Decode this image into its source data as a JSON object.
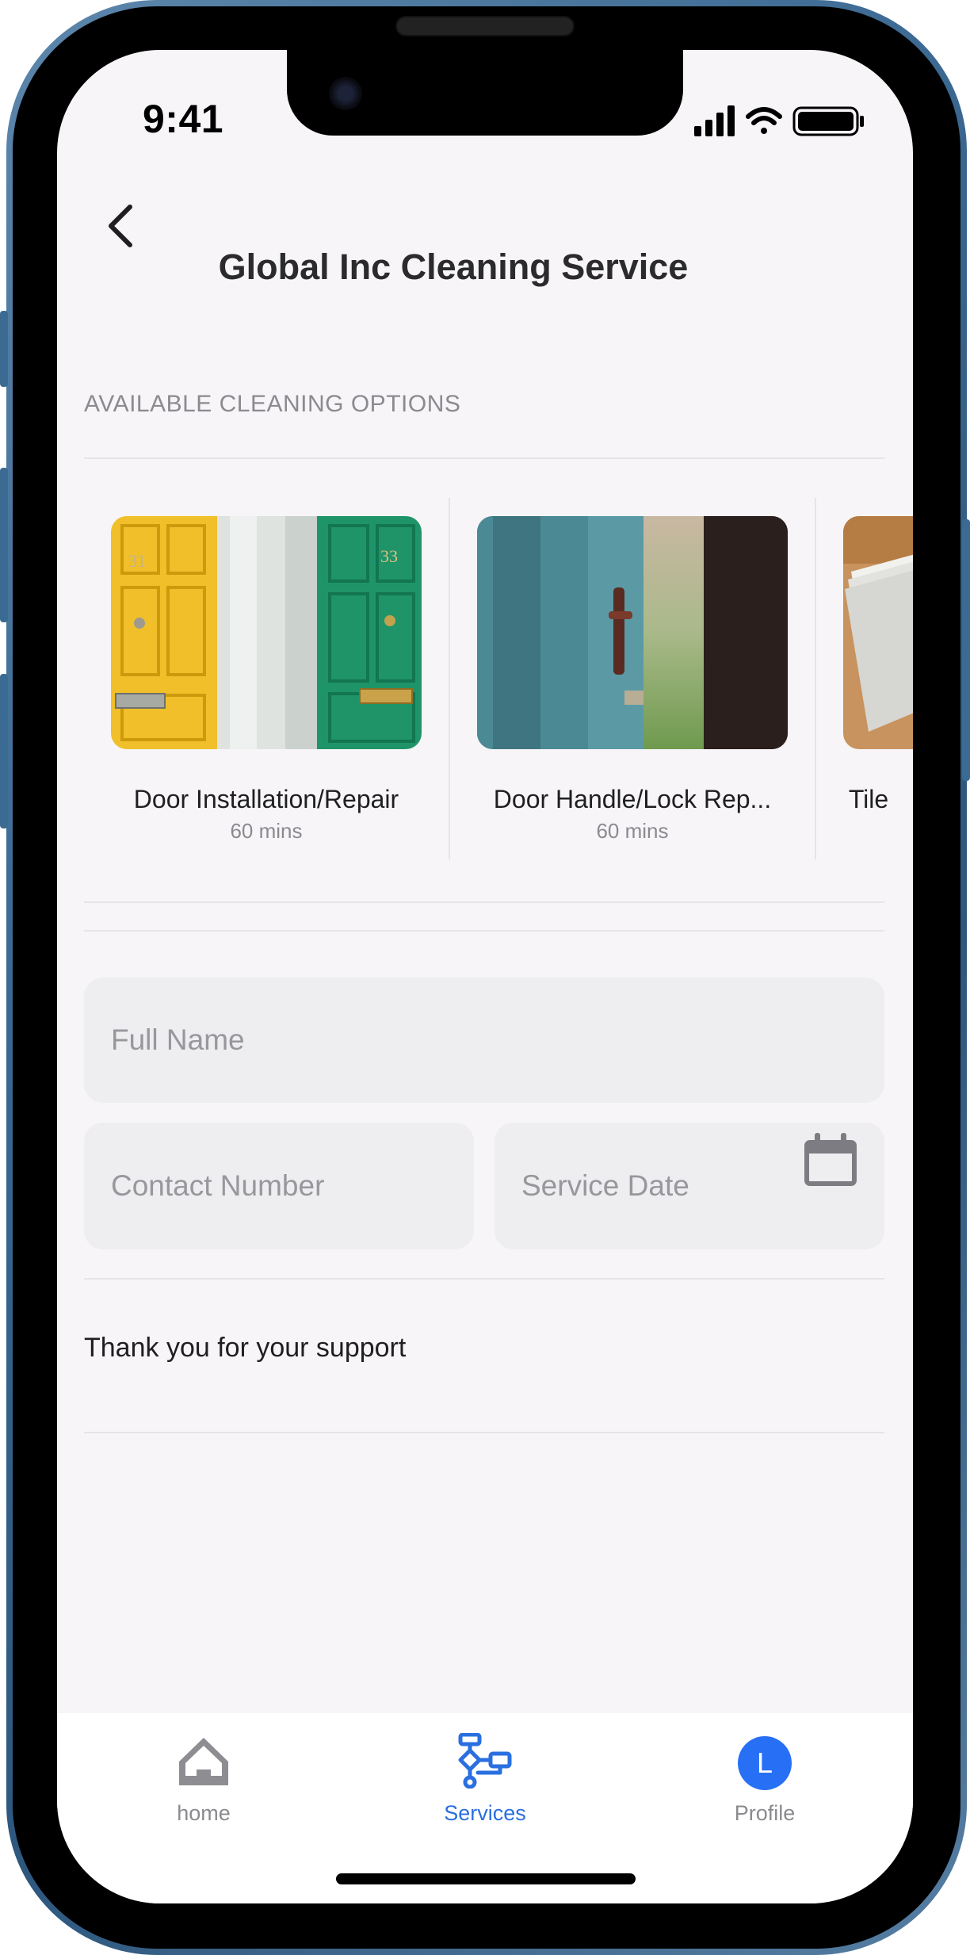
{
  "status_bar": {
    "time": "9:41"
  },
  "header": {
    "title": "Global Inc Cleaning Service"
  },
  "section_label": "AVAILABLE CLEANING OPTIONS",
  "services": [
    {
      "title": "Door Installation/Repair",
      "duration": "60 mins"
    },
    {
      "title": "Door Handle/Lock Rep...",
      "duration": "60 mins"
    },
    {
      "title": "Tile",
      "duration": ""
    }
  ],
  "form": {
    "full_name_placeholder": "Full Name",
    "contact_placeholder": "Contact Number",
    "date_placeholder": "Service Date"
  },
  "message": "Thank you for your support",
  "tab_bar": {
    "home_label": "home",
    "services_label": "Services",
    "profile_label": "Profile",
    "profile_initial": "L",
    "active_color": "#2a6fe0",
    "avatar_color": "#2770f5"
  },
  "icons": [
    "back-chevron-icon",
    "signal-icon",
    "wifi-icon",
    "battery-icon",
    "calendar-icon",
    "home-icon",
    "services-flow-icon"
  ]
}
